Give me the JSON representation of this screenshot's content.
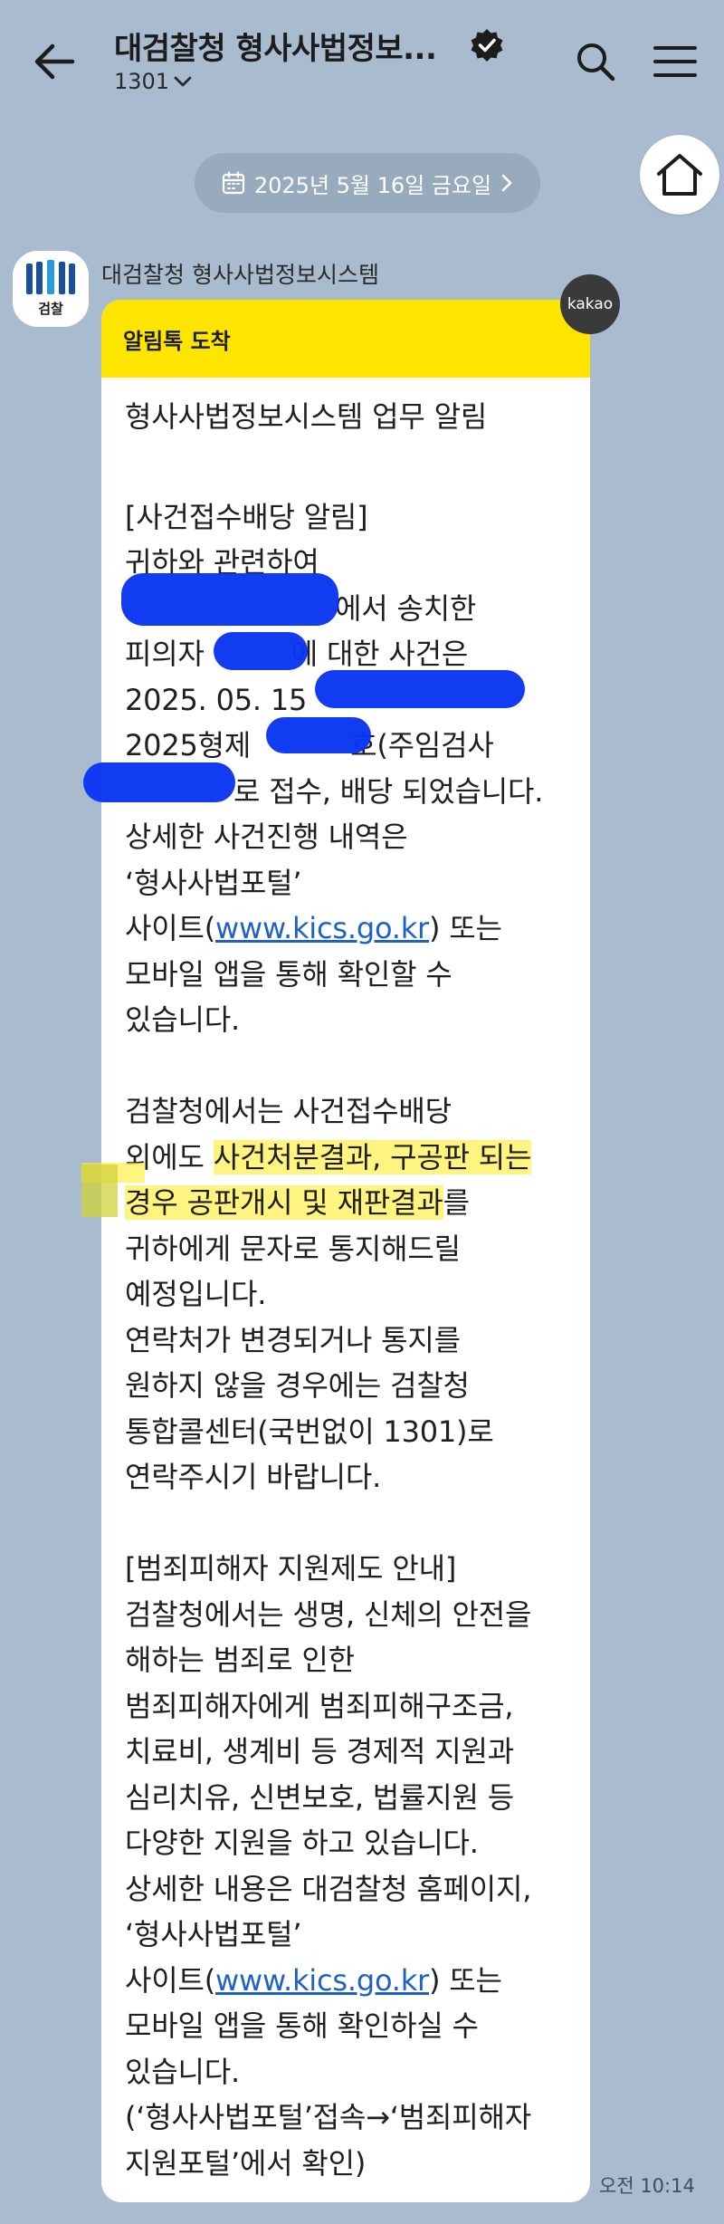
{
  "header": {
    "title": "대검찰청 형사사법정보...",
    "subtitle": "1301",
    "icons": {
      "back": "back-arrow-icon",
      "verified": "verified-badge-icon",
      "dropdown": "chevron-down-icon",
      "search": "search-icon",
      "menu": "hamburger-menu-icon"
    }
  },
  "date_divider": {
    "label": "2025년 5월 16일 금요일",
    "icon": "calendar-icon"
  },
  "home_button": {
    "icon": "home-icon"
  },
  "message": {
    "sender": "대검찰청 형사사법정보시스템",
    "avatar_text": "검찰",
    "badge": "kakao",
    "header": "알림톡 도착",
    "lines": [
      "형사사법정보시스템 업무 알림",
      "",
      "[사건접수배당 알림]",
      "귀하와 관련하여",
      "에서 송치한",
      "피의자",
      "2025. 05. 15",
      "2025형제",
      "로 접수, 배당 되었습니다.",
      "상세한 사건진행 내역은",
      "‘형사사법포털’",
      "사이트(",
      "www.kics.go.kr",
      ") 또는",
      "모바일 앱을 통해 확인할 수",
      "있습니다.",
      "",
      "검찰청에서는 사건접수배당",
      "외에도 사건처분결과, 구공판 되는",
      "경우 공판개시 및 재판결과를",
      "귀하에게 문자로 통지해드릴",
      "예정입니다.",
      "연락처가 변경되거나 통지를",
      "원하지 않을 경우에는 검찰청",
      "통합콜센터(국번없이 1301)로",
      "연락주시기 바랍니다.",
      "",
      "[범죄피해자 지원제도 안내]",
      "검찰청에서는 생명, 신체의 안전을",
      "해하는 범죄로 인한",
      "범죄피해자에게 범죄피해구조금,",
      "치료비, 생계비 등 경제적 지원과",
      "심리치유, 신변보호, 법률지원 등",
      "다양한 지원을 하고 있습니다.",
      "상세한 내용은 대검찰청 홈페이지,",
      "‘형사사법포털’",
      "사이트(",
      "www.kics.go.kr",
      ") 또는",
      "모바일 앱을 통해 확인하실 수",
      "있습니다.",
      "(‘형사사법포털’접속→‘범죄피해자",
      "지원포털’에서 확인)"
    ],
    "fragments": {
      "l5_after": "에 대한 사건은",
      "l7_after": "호(주임검사",
      "l10_pre": "외에도 ",
      "l10_hl": "사건처분결과, 구공판 되는",
      "l11_hl": "경우 공판개시 및 재판결과",
      "l11_after": "를"
    },
    "time": "오전 10:14"
  },
  "colors": {
    "background": "#a9bccf",
    "alimtalk_header": "#fee500",
    "bubble": "#ffffff",
    "link": "#1f62c6",
    "redaction": "#0a36f2",
    "highlight": "#fff030"
  }
}
